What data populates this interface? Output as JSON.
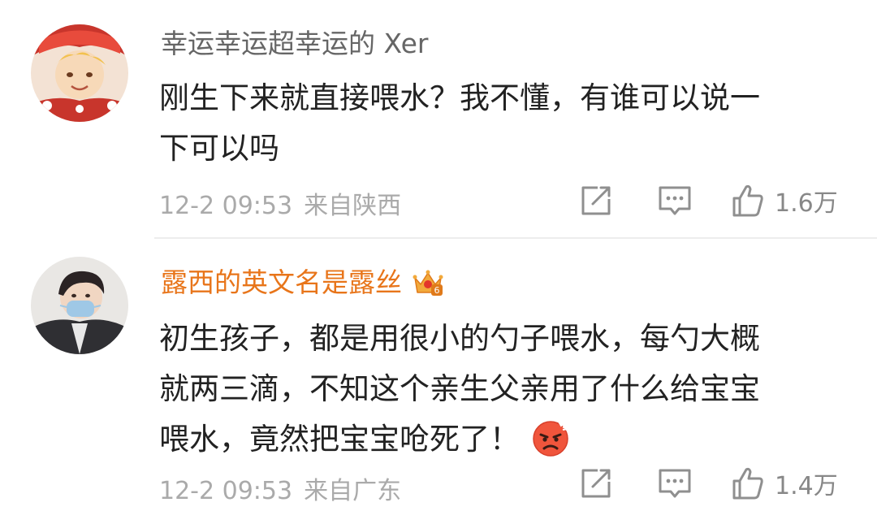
{
  "comments": [
    {
      "username": "幸运幸运超幸运的 Xer",
      "body_lines": [
        "刚生下来就直接喂水？我不懂，有谁可以说一",
        "下可以吗"
      ],
      "time": "12-2 09:53",
      "source": "来自陕西",
      "likes": "1.6万",
      "username_color": "#666666"
    },
    {
      "username": "露西的英文名是露丝",
      "body_lines": [
        "初生孩子，都是用很小的勺子喂水，每勺大概",
        "就两三滴，不知这个亲生父亲用了什么给宝宝",
        "喂水，竟然把宝宝呛死了！"
      ],
      "time": "12-2 09:53",
      "source": "来自广东",
      "likes": "1.4万",
      "username_color": "#e8751a"
    }
  ],
  "icons": {
    "share": "share-icon",
    "comment": "comment-icon",
    "like": "thumbs-up-icon",
    "vip": "crown-vip-icon",
    "emoji": "angry-face-emoji-icon"
  }
}
